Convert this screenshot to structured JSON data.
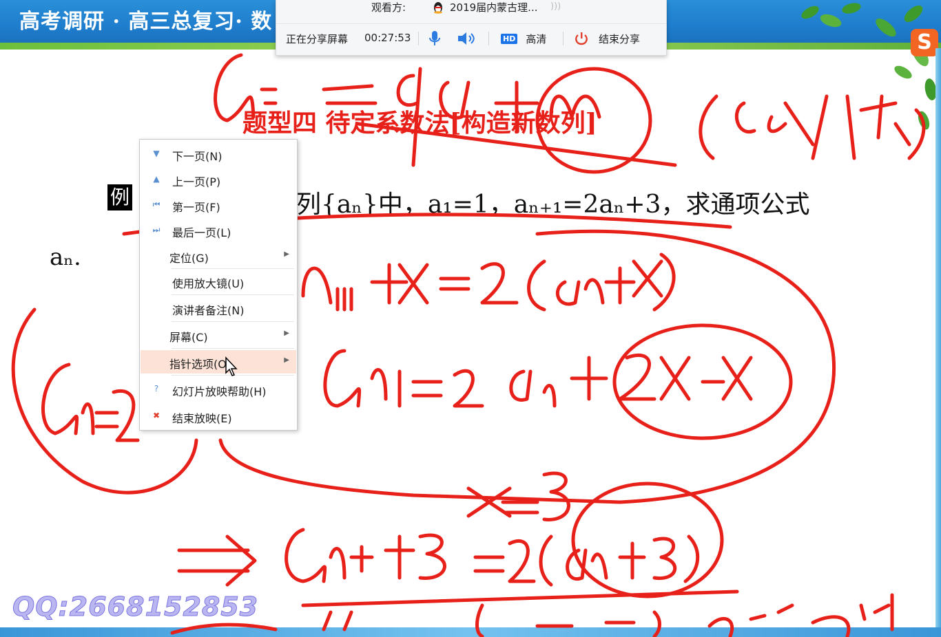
{
  "slide": {
    "header_title": "高考调研 · 高三总复习· 数",
    "title": "题型四   待定系数法[构造新数列]",
    "example_badge": "例",
    "problem_line1": "列{aₙ}中，a₁=1，aₙ₊₁=2aₙ+3，求通项公式",
    "problem_line2": "aₙ."
  },
  "share_toolbar": {
    "viewer_label": "观看方:",
    "viewer_name": "2019届内蒙古理...",
    "status": "正在分享屏幕",
    "timer": "00:27:53",
    "hd_badge": "HD",
    "hd_label": "高清",
    "end_label": "结束分享"
  },
  "context_menu": {
    "items": [
      {
        "label": "下一页(N)",
        "icon": "triangle-down-icon"
      },
      {
        "label": "上一页(P)",
        "icon": "triangle-up-icon"
      },
      {
        "label": "第一页(F)",
        "icon": "first-page-icon"
      },
      {
        "label": "最后一页(L)",
        "icon": "last-page-icon"
      },
      {
        "label": "定位(G)",
        "submenu": true
      },
      {
        "label": "使用放大镜(U)"
      },
      {
        "label": "演讲者备注(N)"
      },
      {
        "label": "屏幕(C)",
        "submenu": true
      },
      {
        "label": "指针选项(O)",
        "submenu": true,
        "highlighted": true
      },
      {
        "label": "幻灯片放映帮助(H)",
        "icon": "help-icon"
      },
      {
        "label": "结束放映(E)",
        "icon": "end-show-icon"
      }
    ]
  },
  "watermark": "QQ:2668152853",
  "ime_logo": "S",
  "colors": {
    "ink": "#e8201a",
    "banner": "#1e7ccc",
    "menu_highlight": "#fde3d7",
    "watermark": "#b9b6f2"
  }
}
